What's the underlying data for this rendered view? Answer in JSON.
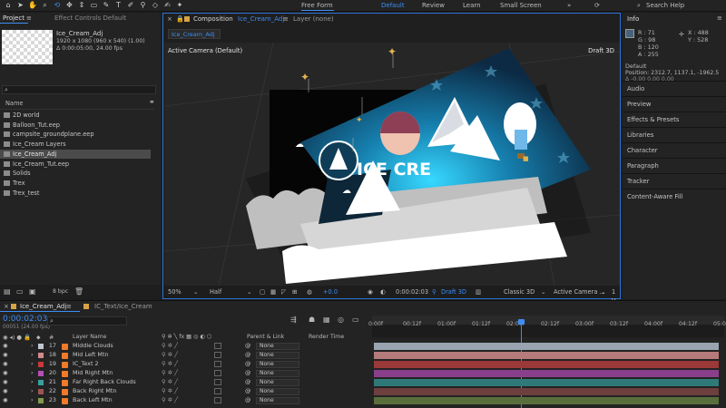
{
  "toolbar": {
    "tools": [
      "home-icon",
      "selection-icon",
      "hand-icon",
      "zoom-icon",
      "camera-orbit-icon",
      "camera-pan-icon",
      "camera-dolly-icon",
      "rectangle-icon",
      "pen-icon",
      "type-icon",
      "brush-icon",
      "clone-icon",
      "eraser-icon",
      "roto-icon",
      "puppet-icon"
    ],
    "free_form": "Free Form",
    "workspaces": [
      "Default",
      "Review",
      "Learn",
      "Small Screen"
    ],
    "active_workspace": "Default",
    "search_placeholder": "Search Help"
  },
  "project": {
    "tab_label": "Project",
    "effect_controls_label": "Effect Controls Default",
    "selected_name": "Ice_Cream_Adj",
    "selected_res": "1920 x 1080 (960 x 540) (1.00)",
    "selected_dur": "Δ 0:00:05:00, 24.00 fps",
    "column_name": "Name",
    "items": [
      "2D world",
      "Balloon_Tut.eep",
      "campsite_groundplane.eep",
      "Ice_Cream Layers",
      "Ice_Cream_Adj",
      "Ice_Cream_Tut.eep",
      "Solids",
      "Trex",
      "Trex_test"
    ],
    "selected_index": 4,
    "bpc": "8 bpc"
  },
  "composition": {
    "tab_prefix": "Composition",
    "tab_name": "Ice_Cream_Adj",
    "layer_tab": "Layer (none)",
    "sub_tab": "Ice_Cream_Adj",
    "active_camera": "Active Camera (Default)",
    "renderer": "Draft 3D",
    "logo_text": "ICE CRE",
    "bar": {
      "zoom": "50%",
      "resolution": "Half",
      "exposure": "+0.0",
      "timecode": "0:00:02:03",
      "draft3d": "Draft 3D",
      "renderer": "Classic 3D",
      "camera": "Active Camera ...",
      "views": "1 V"
    }
  },
  "info": {
    "title": "Info",
    "r": "R : 71",
    "g": "G : 98",
    "b": "B : 120",
    "a": "A : 255",
    "x": "X : 488",
    "y": "Y : 528",
    "default_label": "Default",
    "position": "Position: 2312.7, 1137.1, -1962.5",
    "position2": "Δ -0.00 0.00 0.00",
    "swatch_color": "#47627a"
  },
  "panels": [
    "Audio",
    "Preview",
    "Effects & Presets",
    "Libraries",
    "Character",
    "Paragraph",
    "Tracker",
    "Content-Aware Fill"
  ],
  "timeline": {
    "tab_name": "Ice_Cream_Adj",
    "tab2_name": "IC_Text/Ice_Cream",
    "timecode": "0:00:02:03",
    "frames": "00051 (24.00 fps)",
    "col_layer_name": "Layer Name",
    "col_parent": "Parent & Link",
    "col_render": "Render Time",
    "ruler": [
      "0:00f",
      "00:12f",
      "01:00f",
      "01:12f",
      "02:00f",
      "02:12f",
      "03:00f",
      "03:12f",
      "04:00f",
      "04:12f",
      "05:0"
    ],
    "layers": [
      {
        "num": "17",
        "name": "Middle Clouds",
        "parent": "None",
        "color": "#9aa4b0",
        "label": "#bfc6cf",
        "start": 0.0,
        "end": 1.0
      },
      {
        "num": "18",
        "name": "Mid Left Mtn",
        "parent": "None",
        "color": "#b57a7a",
        "label": "#d08b8b",
        "start": 0.0,
        "end": 1.0
      },
      {
        "num": "19",
        "name": "IC_Text 2",
        "parent": "None",
        "color": "#9b3838",
        "label": "#c63a3a",
        "start": 0.0,
        "end": 1.0
      },
      {
        "num": "20",
        "name": "Mid Right Mtn",
        "parent": "None",
        "color": "#8a3f8a",
        "label": "#b44fb4",
        "start": 0.0,
        "end": 1.0
      },
      {
        "num": "21",
        "name": "Far Right Back Clouds",
        "parent": "None",
        "color": "#2f7a78",
        "label": "#38a09c",
        "start": 0.0,
        "end": 1.0
      },
      {
        "num": "22",
        "name": "Back Right Mtn",
        "parent": "None",
        "color": "#6e3f3f",
        "label": "#9b5555",
        "start": 0.0,
        "end": 1.0
      },
      {
        "num": "23",
        "name": "Back Left Mtn",
        "parent": "None",
        "color": "#5a6e3c",
        "label": "#7d9a4e",
        "start": 0.0,
        "end": 1.0
      }
    ],
    "playhead_fraction": 0.425
  },
  "colors": {
    "accent": "#3d8df5",
    "comp_border": "#2e73d8"
  }
}
